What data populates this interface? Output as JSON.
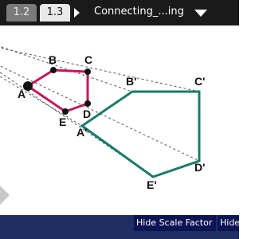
{
  "tabs": [
    {
      "label": "1.2",
      "active": false
    },
    {
      "label": "1.3",
      "active": true
    }
  ],
  "document": {
    "title": "Connecting_...ing"
  },
  "labels": {
    "A": "A",
    "B": "B",
    "C": "C",
    "D": "D",
    "E": "E",
    "A_prime": "A'",
    "B_prime": "B'",
    "C_prime": "C'",
    "D_prime": "D'",
    "E_prime": "E'"
  },
  "softkeys": [
    {
      "label": "Hide Scale Factor"
    },
    {
      "label": "Hide"
    }
  ],
  "colors": {
    "topbar": "#1a1a1a",
    "preimage": "#c2185b",
    "image": "#1b7a6a",
    "bottombar": "#1e2e63",
    "softkey": "#0c1454"
  }
}
